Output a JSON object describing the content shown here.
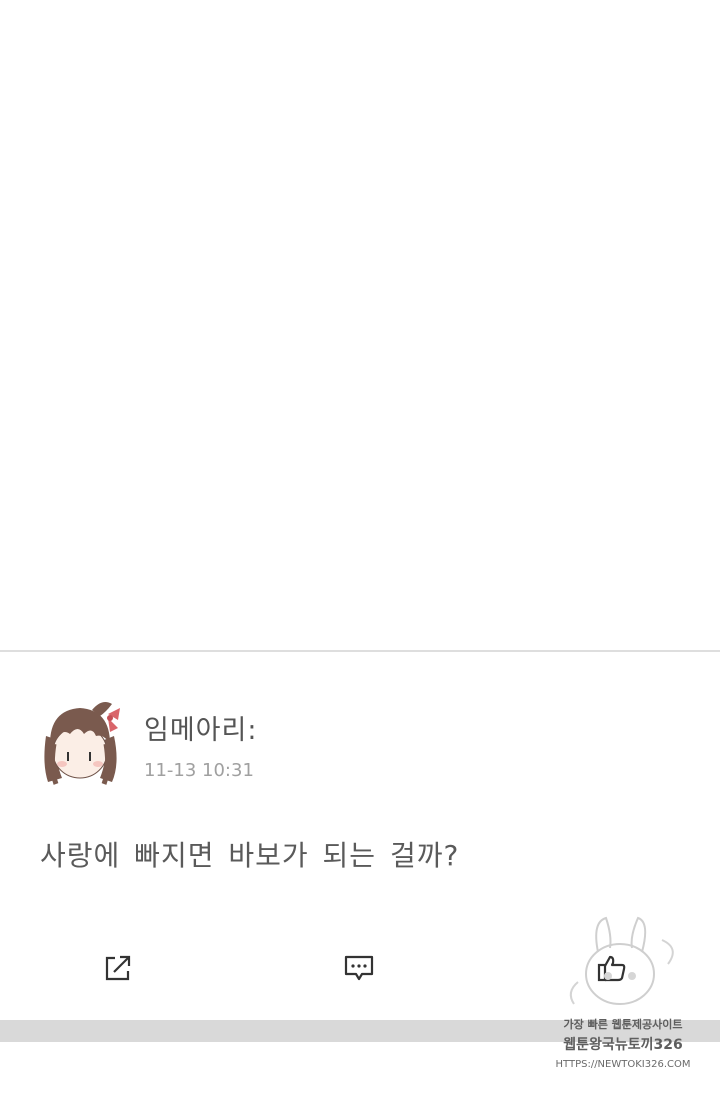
{
  "post": {
    "username": "임메아리:",
    "timestamp": "11-13  10:31",
    "text": "사랑에 빠지면 바보가 되는 걸까?"
  },
  "actions": {
    "share_icon": "share-external-icon",
    "comment_icon": "comment-bubble-icon",
    "like_icon": "thumbs-up-icon"
  },
  "watermark": {
    "line1": "가장 빠른 웹툰제공사이트",
    "line2": "웹툰왕국뉴토끼326",
    "line3": "HTTPS://NEWTOKI326.COM"
  },
  "colors": {
    "divider": "#dedede",
    "text": "#5a5a5a",
    "muted": "#a0a0a0",
    "bar": "#d9d9d9"
  }
}
